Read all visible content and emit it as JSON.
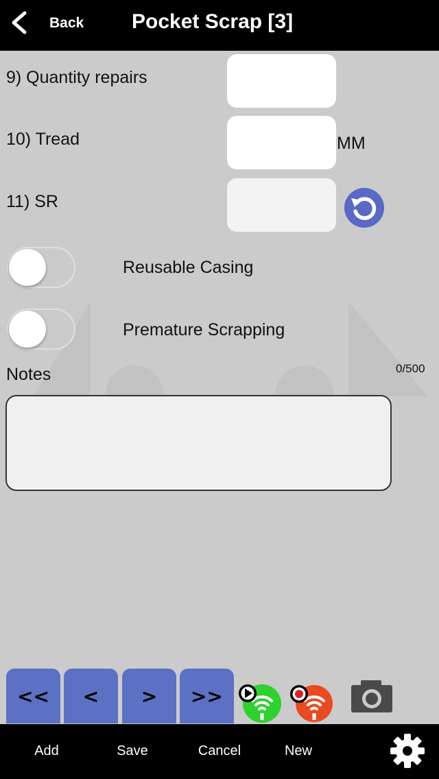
{
  "header": {
    "back_label": "Back",
    "title": "Pocket Scrap [3]",
    "back_icon": "chevron-left-icon"
  },
  "form": {
    "quantity_repairs": {
      "label": "9) Quantity repairs",
      "value": ""
    },
    "tread": {
      "label": "10) Tread",
      "value": "",
      "unit": "MM"
    },
    "sr": {
      "label": "11) SR",
      "value": "",
      "action_icon": "refresh-icon"
    },
    "reusable_casing": {
      "label": "Reusable Casing",
      "on": false
    },
    "premature_scrapping": {
      "label": "Premature Scrapping",
      "on": false
    },
    "notes": {
      "label": "Notes",
      "value": "",
      "counter": "0/500"
    }
  },
  "record_nav": {
    "first_label": "<<",
    "prev_label": "<",
    "next_label": ">",
    "last_label": ">>",
    "wifi_play_icon": "wifi-play-icon",
    "wifi_record_icon": "wifi-record-icon",
    "camera_icon": "camera-icon"
  },
  "toolbar": {
    "add_label": "Add",
    "save_label": "Save",
    "cancel_label": "Cancel",
    "new_label": "New",
    "settings_icon": "gear-icon"
  },
  "colors": {
    "background": "#cbcbcb",
    "bar": "#000000",
    "nav_button": "#5b71c4",
    "refresh_icon": "#5a68c8",
    "wifi_play": "#2ed12e",
    "wifi_record": "#ea4a1f"
  }
}
